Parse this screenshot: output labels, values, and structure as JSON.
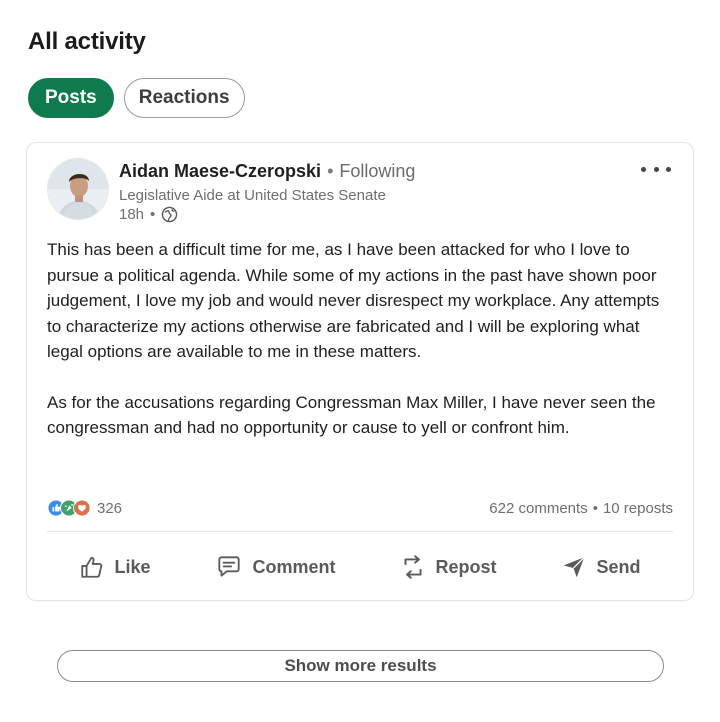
{
  "section": {
    "title": "All activity"
  },
  "filters": {
    "items": [
      {
        "label": "Posts",
        "active": true
      },
      {
        "label": "Reactions",
        "active": false
      }
    ]
  },
  "post": {
    "author": {
      "name": "Aidan Maese-Czeropski",
      "connection_sep": "•",
      "connection": "Following",
      "headline": "Legislative Aide at United States Senate",
      "avatar_icon": "profile-photo"
    },
    "meta": {
      "time": "18h",
      "sep": "•",
      "visibility_icon": "globe-icon"
    },
    "more_icon": "ellipsis-icon",
    "body": {
      "p1": "This has been a difficult time for me, as I have been attacked for who I love to pursue a political agenda. While some of my actions in the past have shown poor judgement, I love my job and would never disrespect my workplace. Any attempts to characterize my actions otherwise are fabricated and I will be exploring what legal options are available to me in these matters.",
      "p2": "As for the accusations regarding Congressman Max Miller, I have never seen the congressman and had no opportunity or cause to yell or confront him."
    },
    "reactions": {
      "count": "326",
      "icons": [
        "like-icon",
        "celebrate-icon",
        "love-icon"
      ]
    },
    "stats": {
      "comments": "622 comments",
      "sep": "•",
      "reposts": "10 reposts"
    },
    "actions": {
      "like": "Like",
      "comment": "Comment",
      "repost": "Repost",
      "send": "Send"
    }
  },
  "footer": {
    "show_more": "Show more results"
  },
  "colors": {
    "accent_green": "#0f7a4e",
    "text_primary": "#1f1f1f",
    "text_secondary": "#6e6e6e"
  }
}
